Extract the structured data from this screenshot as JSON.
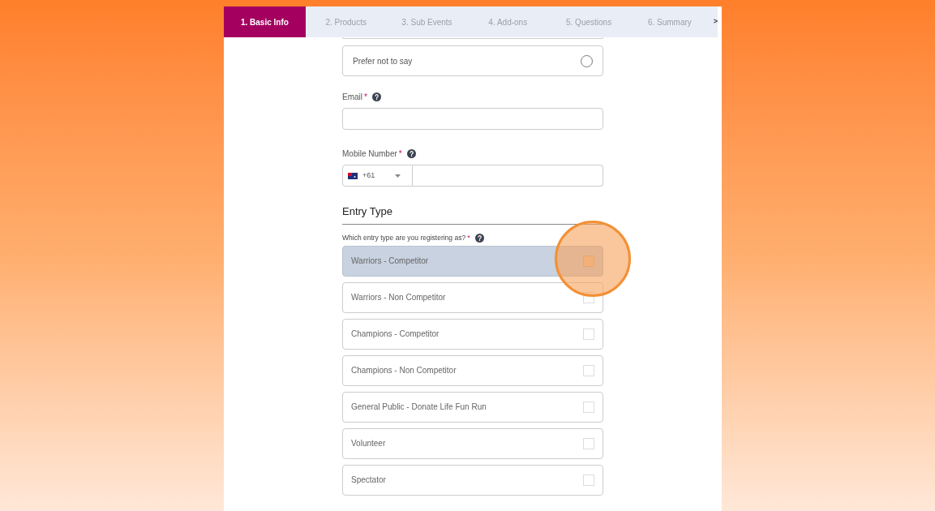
{
  "tabs": [
    {
      "label": "1. Basic Info",
      "selected": true
    },
    {
      "label": "2. Products",
      "selected": false
    },
    {
      "label": "3. Sub Events",
      "selected": false
    },
    {
      "label": "4. Add-ons",
      "selected": false
    },
    {
      "label": "5. Questions",
      "selected": false
    },
    {
      "label": "6. Summary",
      "selected": false
    }
  ],
  "tabs_more": ">",
  "gender_option": {
    "label": "Prefer not to say",
    "selected": false
  },
  "email": {
    "label": "Email",
    "required": "*"
  },
  "mobile": {
    "label": "Mobile Number",
    "required": "*",
    "country_code": "+61"
  },
  "entry_type": {
    "heading": "Entry Type",
    "question": "Which entry type are you registering as?",
    "required": "*",
    "options": [
      {
        "label": "Warriors - Competitor",
        "selected": true
      },
      {
        "label": "Warriors - Non Competitor",
        "selected": false
      },
      {
        "label": "Champions - Competitor",
        "selected": false
      },
      {
        "label": "Champions - Non Competitor",
        "selected": false
      },
      {
        "label": "General Public - Donate Life Fun Run",
        "selected": false
      },
      {
        "label": "Volunteer",
        "selected": false
      },
      {
        "label": "Spectator",
        "selected": false
      }
    ]
  }
}
